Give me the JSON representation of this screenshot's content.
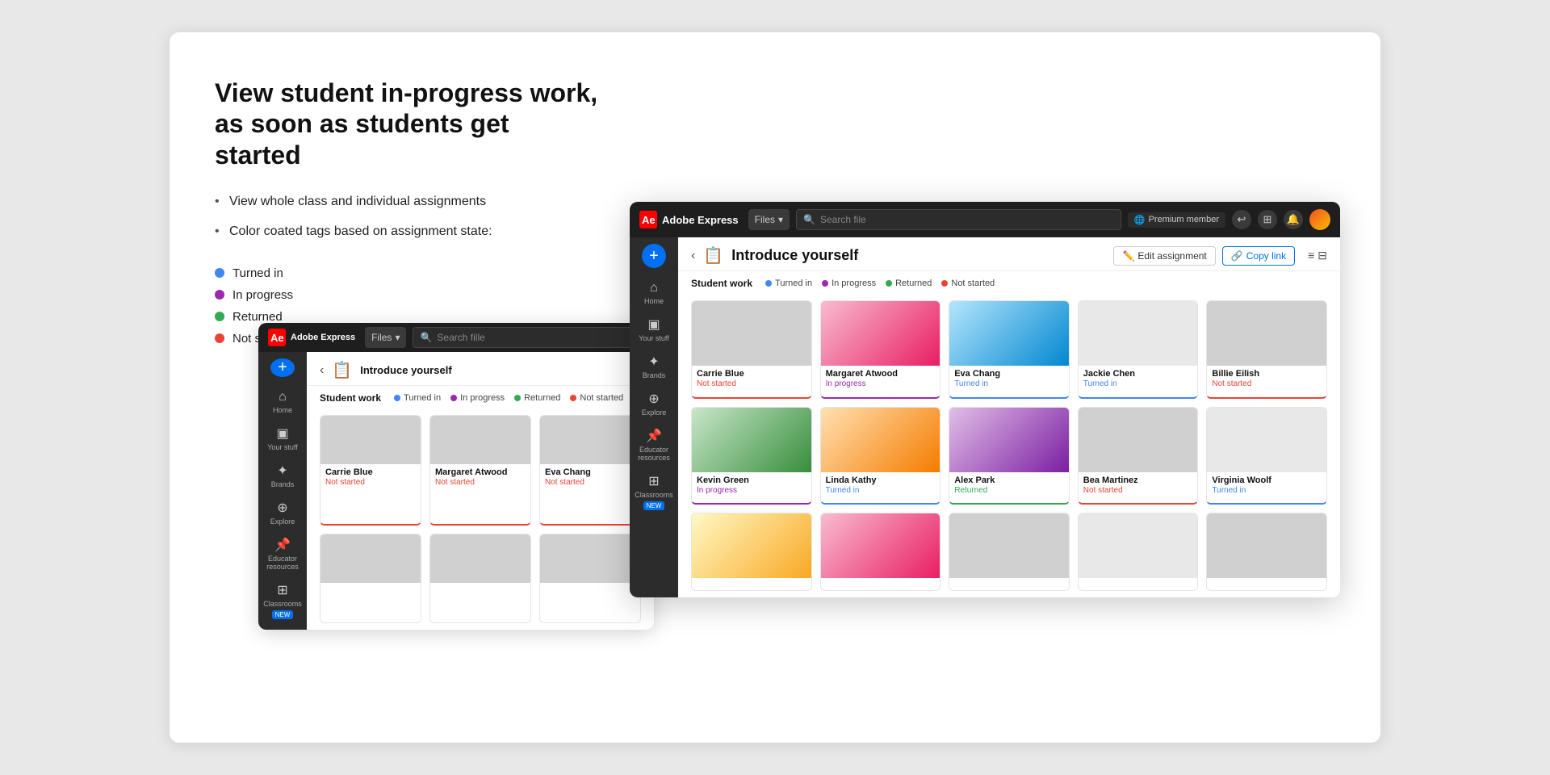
{
  "page": {
    "title": "View student in-progress work, as soon as students get started",
    "bullets": [
      "View whole class and individual assignments",
      "Color coated tags based on assignment state:"
    ],
    "tags": [
      {
        "label": "Turned in",
        "color_class": "dot-blue"
      },
      {
        "label": "In progress",
        "color_class": "dot-purple"
      },
      {
        "label": "Returned",
        "color_class": "dot-green"
      },
      {
        "label": "Not started",
        "color_class": "dot-red"
      }
    ]
  },
  "app_large": {
    "topbar": {
      "brand": "Adobe Express",
      "dropdown": "Files",
      "search_placeholder": "Search file",
      "premium_label": "Premium member",
      "icons": [
        "↩",
        "⊞",
        "🔔"
      ]
    },
    "sidebar": [
      {
        "icon": "⌂",
        "label": "Home"
      },
      {
        "icon": "▣",
        "label": "Your stuff"
      },
      {
        "icon": "✦",
        "label": "Brands"
      },
      {
        "icon": "⊕",
        "label": "Explore"
      },
      {
        "icon": "📌",
        "label": "Educator resources"
      },
      {
        "icon": "⊞",
        "label": "Classrooms",
        "badge": "NEW"
      }
    ],
    "assignment": {
      "title": "Introduce yourself",
      "icon": "📋",
      "edit_label": "Edit assignment",
      "copy_label": "Copy link"
    },
    "student_work_label": "Student work",
    "status_legend": [
      {
        "label": "Turned in",
        "color": "#4285f4"
      },
      {
        "label": "In progress",
        "color": "#9c27b0"
      },
      {
        "label": "Returned",
        "color": "#34a853"
      },
      {
        "label": "Not started",
        "color": "#ea4335"
      }
    ],
    "students_row1": [
      {
        "name": "Carrie Blue",
        "status": "Not started",
        "status_class": "not-started",
        "border": "ae-card-border-red",
        "thumb": "thumb-gray"
      },
      {
        "name": "Margaret Atwood",
        "status": "In progress",
        "status_class": "in-progress",
        "border": "ae-card-border-purple",
        "thumb": "thumb-pink"
      },
      {
        "name": "Eva Chang",
        "status": "Turned in",
        "status_class": "turned-in",
        "border": "ae-card-border-blue",
        "thumb": "thumb-lightblue"
      },
      {
        "name": "Jackie Chen",
        "status": "Turned in",
        "status_class": "turned-in",
        "border": "ae-card-border-blue",
        "thumb": "thumb-sketch"
      },
      {
        "name": "Billie Eilish",
        "status": "Not started",
        "status_class": "not-started",
        "border": "ae-card-border-red",
        "thumb": "thumb-gray"
      }
    ],
    "students_row2": [
      {
        "name": "Kevin Green",
        "status": "In progress",
        "status_class": "in-progress",
        "border": "ae-card-border-purple",
        "thumb": "thumb-green"
      },
      {
        "name": "Linda Kathy",
        "status": "Turned in",
        "status_class": "turned-in",
        "border": "ae-card-border-blue",
        "thumb": "thumb-orange"
      },
      {
        "name": "Alex Park",
        "status": "Returned",
        "status_class": "returned",
        "border": "ae-card-border-green",
        "thumb": "thumb-purple"
      },
      {
        "name": "Bea Martinez",
        "status": "Not started",
        "status_class": "not-started",
        "border": "ae-card-border-red",
        "thumb": "thumb-gray"
      },
      {
        "name": "Virginia Woolf",
        "status": "Turned in",
        "status_class": "turned-in",
        "border": "ae-card-border-blue",
        "thumb": "thumb-sketch"
      }
    ]
  },
  "app_small": {
    "topbar": {
      "brand": "Adobe Express",
      "dropdown": "Files",
      "search_placeholder": "Search fille"
    },
    "assignment": {
      "title": "Introduce yourself",
      "icon": "📋"
    },
    "student_work_label": "Student work",
    "students": [
      {
        "name": "Carrie Blue",
        "status": "Not started",
        "status_class": "not-started",
        "border": "ae-card-border-red",
        "thumb": "thumb-gray"
      },
      {
        "name": "Margaret Atwood",
        "status": "Not started",
        "status_class": "not-started",
        "border": "ae-card-border-red",
        "thumb": "thumb-gray"
      },
      {
        "name": "Eva Chang",
        "status": "Not started",
        "status_class": "not-started",
        "border": "ae-card-border-red",
        "thumb": "thumb-gray"
      }
    ]
  }
}
